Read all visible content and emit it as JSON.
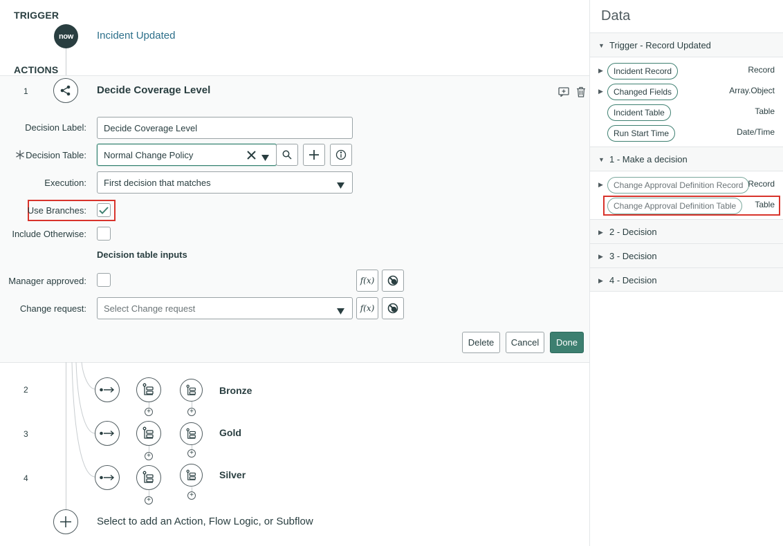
{
  "trigger": {
    "section": "TRIGGER",
    "badge": "now",
    "title": "Incident Updated"
  },
  "actions": {
    "section": "ACTIONS"
  },
  "action": {
    "number": "1",
    "title": "Decide Coverage Level",
    "fields": {
      "decision_label": {
        "label": "Decision Label:",
        "value": "Decide Coverage Level"
      },
      "decision_table": {
        "label": "Decision Table:",
        "value": "Normal Change Policy"
      },
      "execution": {
        "label": "Execution:",
        "value": "First decision that matches"
      },
      "use_branches": {
        "label": "Use Branches:",
        "checked": true
      },
      "include_otherwise": {
        "label": "Include Otherwise:",
        "checked": false
      }
    },
    "inputs_heading": "Decision table inputs",
    "manager_approved": {
      "label": "Manager approved:",
      "checked": false
    },
    "change_request": {
      "label": "Change request:",
      "placeholder": "Select Change request"
    },
    "fx_label": "f(x)",
    "buttons": {
      "delete": "Delete",
      "cancel": "Cancel",
      "done": "Done"
    }
  },
  "branches": [
    {
      "number": "2",
      "label": "Bronze"
    },
    {
      "number": "3",
      "label": "Gold"
    },
    {
      "number": "4",
      "label": "Silver"
    }
  ],
  "add_prompt": "Select to add an Action, Flow Logic, or Subflow",
  "data_panel": {
    "title": "Data",
    "sections": [
      {
        "label": "Trigger - Record Updated",
        "expanded": true
      },
      {
        "label": "1 - Make a decision",
        "expanded": true
      },
      {
        "label": "2 - Decision",
        "expanded": false
      },
      {
        "label": "3 - Decision",
        "expanded": false
      },
      {
        "label": "4 - Decision",
        "expanded": false
      }
    ],
    "trigger_pills": [
      {
        "label": "Incident Record",
        "type": "Record",
        "expandable": true
      },
      {
        "label": "Changed Fields",
        "type": "Array.Object",
        "expandable": true
      },
      {
        "label": "Incident Table",
        "type": "Table",
        "expandable": false
      },
      {
        "label": "Run Start Time",
        "type": "Date/Time",
        "expandable": false
      }
    ],
    "decision_pills": [
      {
        "label": "Change Approval Definition Record",
        "type": "Record",
        "expandable": true
      },
      {
        "label": "Change Approval Definition Table",
        "type": "Table",
        "expandable": false
      }
    ]
  },
  "colors": {
    "accent": "#3d7f70",
    "highlight": "#d8332b",
    "link": "#2c6f8a",
    "text": "#293e40"
  }
}
